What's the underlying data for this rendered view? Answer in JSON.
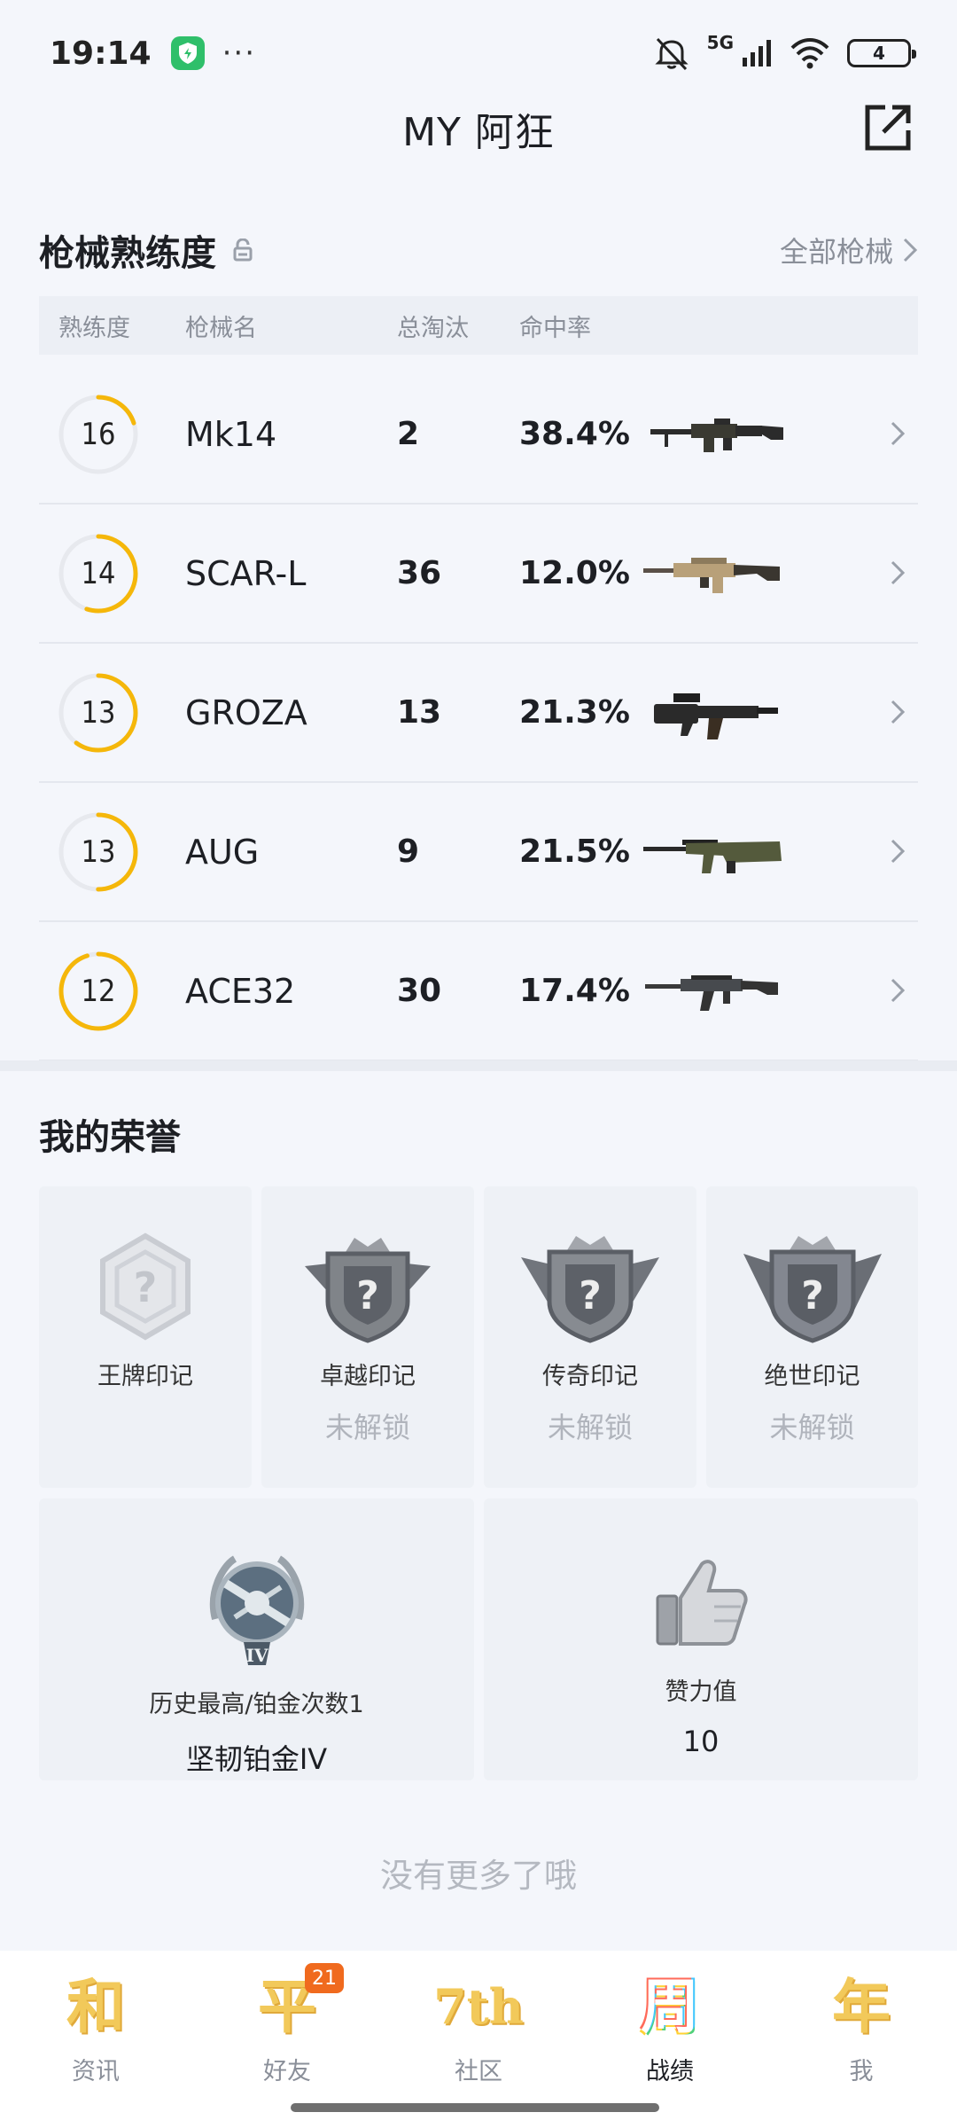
{
  "status_bar": {
    "time": "19:14",
    "dots": "···",
    "network": "5G",
    "battery": "4"
  },
  "header": {
    "title": "MY 阿狂"
  },
  "weapons": {
    "title": "枪械熟练度",
    "all_link": "全部枪械",
    "columns": [
      "熟练度",
      "枪械名",
      "总淘汰",
      "命中率"
    ],
    "rows": [
      {
        "level": "16",
        "progress": 0.2,
        "name": "Mk14",
        "kills": "2",
        "rate": "38.4%"
      },
      {
        "level": "14",
        "progress": 0.55,
        "name": "SCAR-L",
        "kills": "36",
        "rate": "12.0%"
      },
      {
        "level": "13",
        "progress": 0.6,
        "name": "GROZA",
        "kills": "13",
        "rate": "21.3%"
      },
      {
        "level": "13",
        "progress": 0.5,
        "name": "AUG",
        "kills": "9",
        "rate": "21.5%"
      },
      {
        "level": "12",
        "progress": 0.95,
        "name": "ACE32",
        "kills": "30",
        "rate": "17.4%"
      }
    ]
  },
  "honors": {
    "title": "我的荣誉",
    "badges": [
      {
        "label": "王牌印记",
        "status": ""
      },
      {
        "label": "卓越印记",
        "status": "未解锁"
      },
      {
        "label": "传奇印记",
        "status": "未解锁"
      },
      {
        "label": "绝世印记",
        "status": "未解锁"
      }
    ],
    "rank": {
      "label": "历史最高/铂金次数1",
      "value": "坚韧铂金IV"
    },
    "likes": {
      "label": "赞力值",
      "value": "10"
    }
  },
  "footer_text": "没有更多了哦",
  "nav": {
    "items": [
      {
        "glyph": "和",
        "label": "资讯"
      },
      {
        "glyph": "平",
        "label": "好友",
        "badge": "21"
      },
      {
        "glyph": "7th",
        "label": "社区"
      },
      {
        "glyph": "周",
        "label": "战绩"
      },
      {
        "glyph": "年",
        "label": "我"
      }
    ]
  },
  "colors": {
    "accent": "#f5b70a",
    "background": "#f4f6fb",
    "badge": "#f06a1e"
  }
}
